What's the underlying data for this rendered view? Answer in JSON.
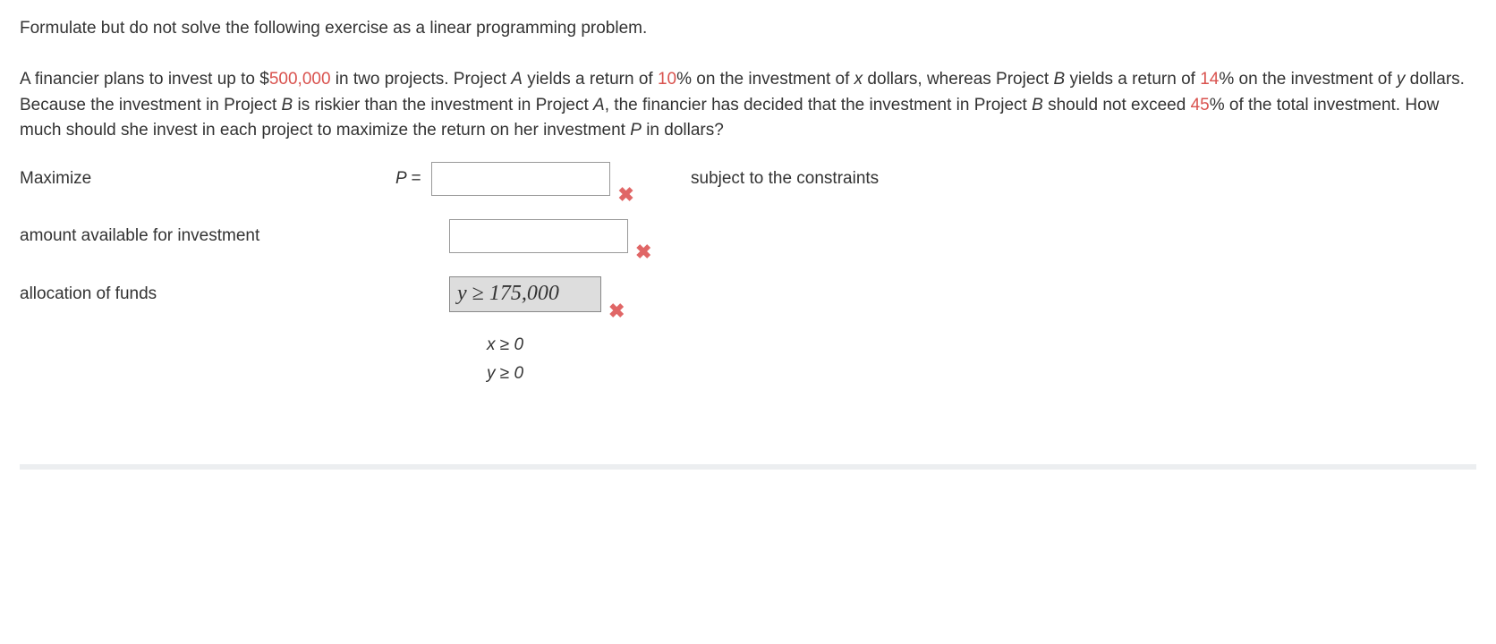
{
  "prompt": {
    "line1": "Formulate but do not solve the following exercise as a linear programming problem.",
    "line2_pre": "A financier plans to invest up to $",
    "amount": "500,000",
    "line2_mid1": " in two projects. Project ",
    "projA": "A",
    "line2_mid2": " yields a return of ",
    "pctA": "10",
    "line2_mid3": "% on the investment of ",
    "varx": "x",
    "line2_mid4": " dollars, whereas Project ",
    "projB": "B",
    "line2_mid5": " yields a return of ",
    "pctB": "14",
    "line2_mid6": "% on the investment of ",
    "vary": "y",
    "line2_mid7": " dollars. Because the investment in Project ",
    "projB2": "B",
    "line2_mid8": " is riskier than the investment in Project ",
    "projA2": "A",
    "line2_mid9": ", the financier has decided that the investment in Project ",
    "projB3": "B",
    "line2_mid10": " should not exceed ",
    "pctLimit": "45",
    "line2_mid11": "% of the total investment. How much should she invest in each project to maximize the return on her investment ",
    "varP": "P",
    "line2_end": " in dollars?"
  },
  "rows": {
    "maximize": {
      "label": "Maximize",
      "lhs": "P  =",
      "after": "subject to the constraints"
    },
    "amount": {
      "label": "amount available for investment"
    },
    "allocation": {
      "label": "allocation of funds",
      "value": "y ≥ 175,000"
    }
  },
  "nonneg": {
    "x": "x ≥ 0",
    "y": "y ≥ 0"
  },
  "marks": {
    "wrong": "✖"
  }
}
